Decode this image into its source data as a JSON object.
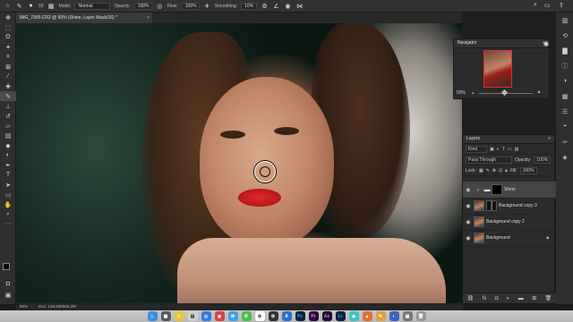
{
  "options_bar": {
    "mode_label": "Mode:",
    "mode_value": "Normal",
    "opacity_label": "Opacity:",
    "opacity_value": "100%",
    "flow_label": "Flow:",
    "flow_value": "100%",
    "smoothing_label": "Smoothing:",
    "smoothing_value": "10%",
    "brush_size": "50"
  },
  "document": {
    "tab_title": "IMG_7995.CR2 @ 50% (Shine, Layer Mask/16) *"
  },
  "navigator": {
    "title": "Navigator",
    "zoom": "50%"
  },
  "layers_panel": {
    "title": "Layers",
    "filter_kind": "Kind",
    "blend_mode": "Pass Through",
    "opacity_label": "Opacity:",
    "opacity_value": "100%",
    "lock_label": "Lock:",
    "fill_label": "Fill:",
    "fill_value": "100%",
    "layers": [
      {
        "name": "Shine",
        "type": "group",
        "selected": true
      },
      {
        "name": "Background copy 3",
        "type": "adjusted"
      },
      {
        "name": "Background copy 2",
        "type": "pixel"
      },
      {
        "name": "Background",
        "type": "locked"
      }
    ]
  },
  "status": {
    "zoom": "50%",
    "doc_size": "Doc: 148.5M/503.2M"
  },
  "colors": {
    "accent": "#31a8ff",
    "panel": "#2b2b2b",
    "foreground_swatch": "#000000",
    "background_swatch": "#ffffff"
  }
}
